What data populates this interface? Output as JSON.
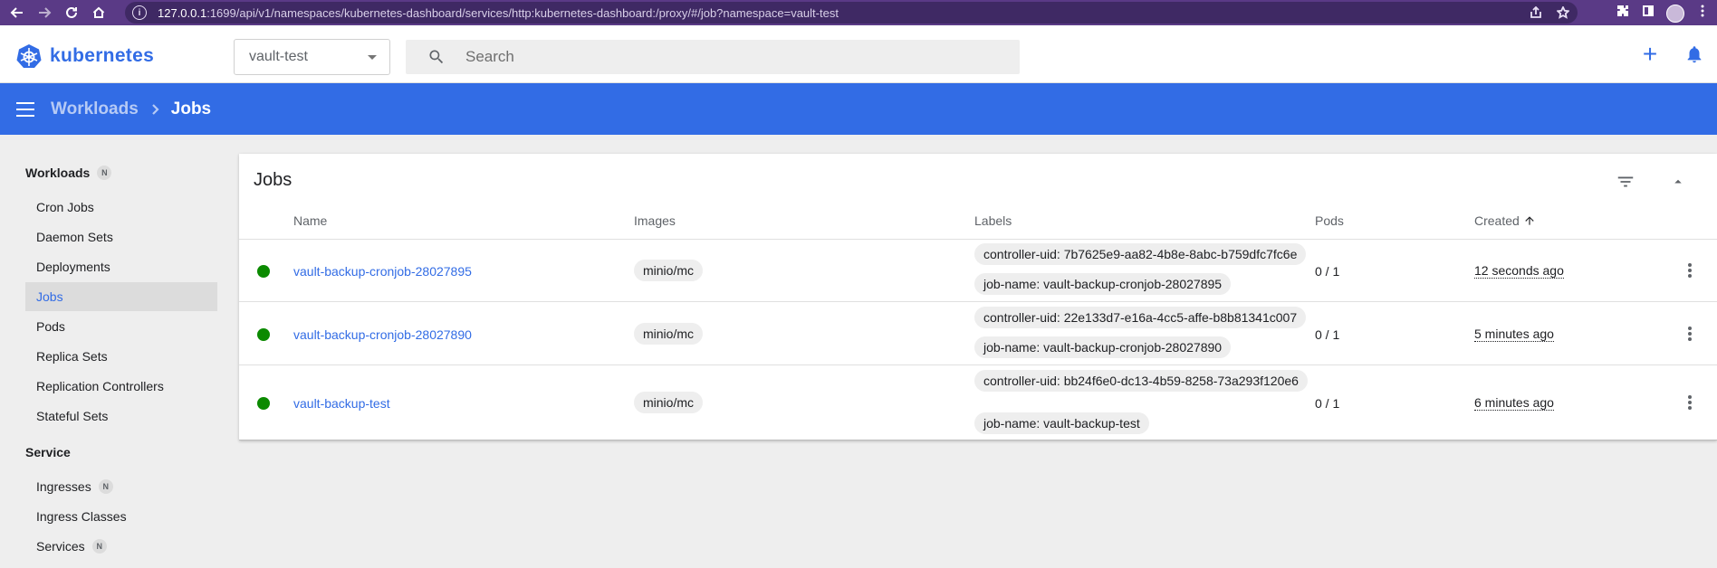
{
  "browser": {
    "url_host": "127.0.0.1",
    "url_rest": ":1699/api/v1/namespaces/kubernetes-dashboard/services/http:kubernetes-dashboard:/proxy/#/job?namespace=vault-test"
  },
  "app": {
    "brand": "kubernetes",
    "accent_color": "#326ce5"
  },
  "toolbar": {
    "namespace": "vault-test",
    "search_placeholder": "Search",
    "create_icon": "plus-icon",
    "notifications_icon": "bell-icon"
  },
  "breadcrumb": {
    "parent": "Workloads",
    "current": "Jobs"
  },
  "sidebar": {
    "workloads_title": "Workloads",
    "workloads_badge": "N",
    "workload_items": [
      {
        "label": "Cron Jobs"
      },
      {
        "label": "Daemon Sets"
      },
      {
        "label": "Deployments"
      },
      {
        "label": "Jobs",
        "active": true
      },
      {
        "label": "Pods"
      },
      {
        "label": "Replica Sets"
      },
      {
        "label": "Replication Controllers"
      },
      {
        "label": "Stateful Sets"
      }
    ],
    "service_title": "Service",
    "service_items": [
      {
        "label": "Ingresses",
        "badge": "N"
      },
      {
        "label": "Ingress Classes"
      },
      {
        "label": "Services",
        "badge": "N"
      }
    ]
  },
  "jobs_card": {
    "title": "Jobs",
    "columns": {
      "name": "Name",
      "images": "Images",
      "labels": "Labels",
      "pods": "Pods",
      "created": "Created"
    },
    "rows": [
      {
        "status": "running",
        "name": "vault-backup-cronjob-28027895",
        "image": "minio/mc",
        "label_uid": "controller-uid: 7b7625e9-aa82-4b8e-8abc-b759dfc7fc6e",
        "label_job": "job-name: vault-backup-cronjob-28027895",
        "pods": "0 / 1",
        "created": "12 seconds ago"
      },
      {
        "status": "running",
        "name": "vault-backup-cronjob-28027890",
        "image": "minio/mc",
        "label_uid": "controller-uid: 22e133d7-e16a-4cc5-affe-b8b81341c007",
        "label_job": "job-name: vault-backup-cronjob-28027890",
        "pods": "0 / 1",
        "created": "5 minutes ago"
      },
      {
        "status": "running",
        "name": "vault-backup-test",
        "image": "minio/mc",
        "label_uid": "controller-uid: bb24f6e0-dc13-4b59-8258-73a293f120e6",
        "label_job": "job-name: vault-backup-test",
        "pods": "0 / 1",
        "created": "6 minutes ago"
      }
    ]
  }
}
